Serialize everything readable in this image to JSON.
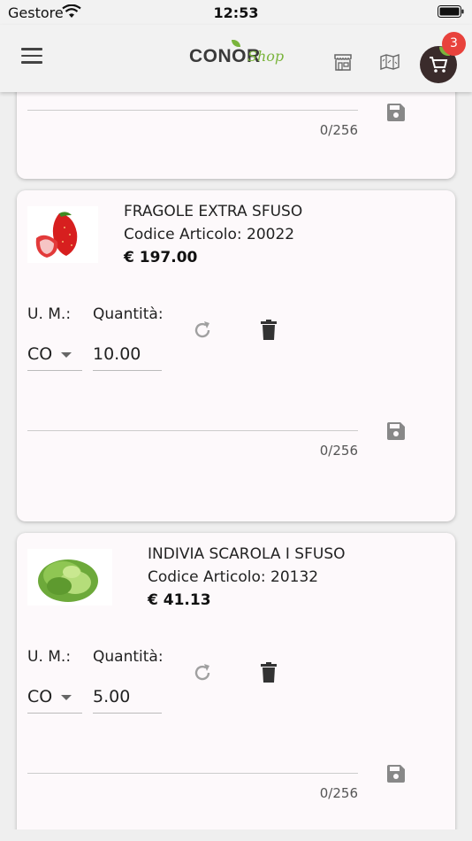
{
  "status_bar": {
    "carrier": "Gestore",
    "time": "12:53"
  },
  "header": {
    "logo_main": "CONOR",
    "logo_sub": "Shop",
    "cart_count": "3",
    "icons": [
      "menu-icon",
      "store-icon",
      "map-icon",
      "cart-icon"
    ]
  },
  "cards": [
    {
      "counter": "0/256"
    },
    {
      "title": "FRAGOLE EXTRA SFUSO",
      "code": "Codice Articolo: 20022",
      "price": "€ 197.00",
      "um_label": "U. M.:",
      "qty_label": "Quantità:",
      "um_value": "CO",
      "qty_value": "10.00",
      "counter": "0/256"
    },
    {
      "title": "INDIVIA SCAROLA I SFUSO",
      "code": "Codice Articolo: 20132",
      "price": "€ 41.13",
      "um_label": "U. M.:",
      "qty_label": "Quantità:",
      "um_value": "CO",
      "qty_value": "5.00",
      "counter": "0/256"
    }
  ],
  "colors": {
    "accent_green": "#7ab43c",
    "badge_red": "#e8423c",
    "cart_dark": "#3a2b2b"
  }
}
